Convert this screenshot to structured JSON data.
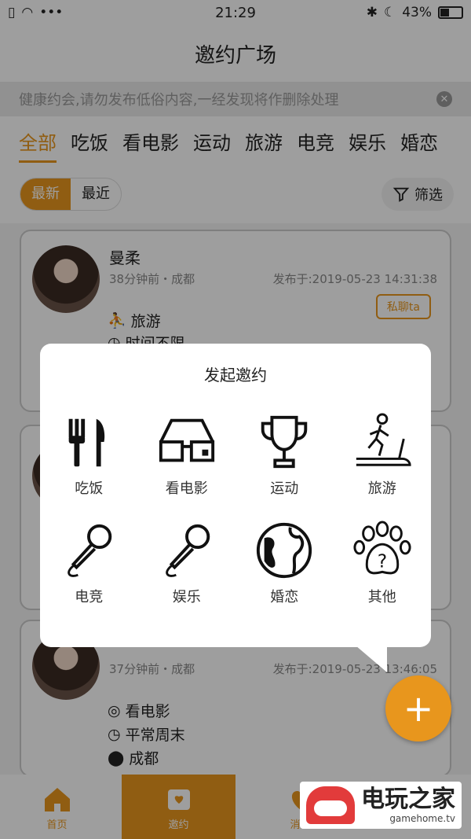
{
  "status_bar": {
    "time": "21:29",
    "battery": "43%",
    "battery_level": 0.43
  },
  "header": {
    "title": "邀约广场"
  },
  "notice": {
    "text": "健康约会,请勿发布低俗内容,一经发现将作删除处理"
  },
  "category_tabs": [
    "全部",
    "吃饭",
    "看电影",
    "运动",
    "旅游",
    "电竞",
    "娱乐",
    "婚恋"
  ],
  "sort_toggle": {
    "latest": "最新",
    "nearby": "最近"
  },
  "filter": {
    "label": "筛选"
  },
  "cards": [
    {
      "name": "曼柔",
      "meta": "38分钟前・成都",
      "posted": "发布于:2019-05-23 14:31:38",
      "chat": "私聊ta",
      "activity": "旅游",
      "time_pref": "时间不限"
    },
    {
      "meta": "37分钟前・成都",
      "posted": "发布于:2019-05-23 13:46:05",
      "activity": "看电影",
      "time_pref": "平常周末",
      "location": "成都"
    }
  ],
  "popup": {
    "title": "发起邀约",
    "items": [
      {
        "label": "吃饭",
        "icon": "utensils-icon"
      },
      {
        "label": "看电影",
        "icon": "glasses-icon"
      },
      {
        "label": "运动",
        "icon": "trophy-icon"
      },
      {
        "label": "旅游",
        "icon": "treadmill-icon"
      },
      {
        "label": "电竞",
        "icon": "microphone-icon"
      },
      {
        "label": "娱乐",
        "icon": "microphone-icon"
      },
      {
        "label": "婚恋",
        "icon": "globe-icon"
      },
      {
        "label": "其他",
        "icon": "paw-question-icon"
      }
    ]
  },
  "bottom_nav": {
    "home": "首页",
    "invite": "邀约",
    "message": "消息"
  },
  "fab": {
    "symbol": "+"
  },
  "watermark": {
    "main": "电玩之家",
    "sub": "gamehome.tv"
  },
  "colors": {
    "accent": "#e8961d"
  }
}
